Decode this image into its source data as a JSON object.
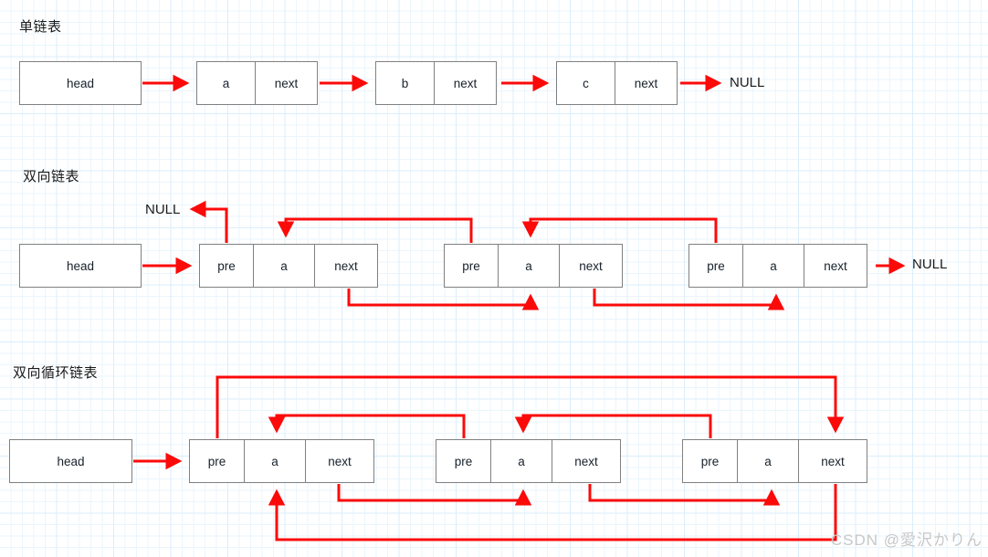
{
  "meta": {
    "accent_color": "#fb0a0a",
    "box_border_color": "#808080",
    "grid_color": "#dbeefb",
    "text_color": "#17202a"
  },
  "sections": [
    {
      "id": "singly",
      "title": "单链表",
      "head_label": "head",
      "nodes": [
        {
          "cells": [
            "a",
            "next"
          ]
        },
        {
          "cells": [
            "b",
            "next"
          ]
        },
        {
          "cells": [
            "c",
            "next"
          ]
        }
      ],
      "terminators": [
        "NULL"
      ]
    },
    {
      "id": "doubly",
      "title": "双向链表",
      "head_label": "head",
      "nodes": [
        {
          "cells": [
            "pre",
            "a",
            "next"
          ]
        },
        {
          "cells": [
            "pre",
            "a",
            "next"
          ]
        },
        {
          "cells": [
            "pre",
            "a",
            "next"
          ]
        }
      ],
      "terminators": [
        "NULL",
        "NULL"
      ]
    },
    {
      "id": "doubly-circular",
      "title": "双向循环链表",
      "head_label": "head",
      "nodes": [
        {
          "cells": [
            "pre",
            "a",
            "next"
          ]
        },
        {
          "cells": [
            "pre",
            "a",
            "next"
          ]
        },
        {
          "cells": [
            "pre",
            "a",
            "next"
          ]
        }
      ],
      "terminators": []
    }
  ],
  "labels": {
    "null_left": "NULL",
    "null_right": "NULL",
    "null_row1": "NULL"
  },
  "watermark": "CSDN @愛沢かりん"
}
